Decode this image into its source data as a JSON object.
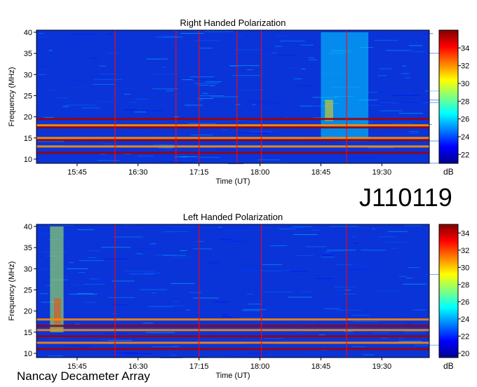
{
  "observation_id": "J110119",
  "station": "Nancay Decameter Array",
  "chart_data": [
    {
      "type": "heatmap",
      "title": "Right Handed Polarization",
      "xlabel": "Time (UT)",
      "ylabel": "Frequency (MHz)",
      "x_ticks": [
        "15:45",
        "16:30",
        "17:15",
        "18:00",
        "18:45",
        "19:30"
      ],
      "x_tick_minutes": [
        945,
        990,
        1035,
        1080,
        1125,
        1170
      ],
      "xlim_minutes": [
        915,
        1205
      ],
      "y_ticks": [
        10,
        15,
        20,
        25,
        30,
        35,
        40
      ],
      "ylim": [
        9,
        40.5
      ],
      "colorbar": {
        "label": "dB",
        "ticks": [
          22,
          24,
          26,
          28,
          30,
          32,
          34
        ],
        "range": [
          21,
          36
        ]
      },
      "strong_bands_mhz": [
        11.5,
        13,
        14.5,
        15,
        17.5,
        18,
        19.5
      ],
      "burst_regions": [
        {
          "t0": 1125,
          "t1": 1160,
          "f0": 15,
          "f1": 40,
          "level": 26
        },
        {
          "t0": 1128,
          "t1": 1134,
          "f0": 19,
          "f1": 24,
          "level": 31
        }
      ],
      "vertical_lines_minutes": [
        973,
        1018,
        1035,
        1063,
        1081,
        1144
      ]
    },
    {
      "type": "heatmap",
      "title": "Left Handed Polarization",
      "xlabel": "Time (UT)",
      "ylabel": "Frequency (MHz)",
      "x_ticks": [
        "15:45",
        "16:30",
        "17:15",
        "18:00",
        "18:45",
        "19:30"
      ],
      "x_tick_minutes": [
        945,
        990,
        1035,
        1080,
        1125,
        1170
      ],
      "xlim_minutes": [
        915,
        1205
      ],
      "y_ticks": [
        10,
        15,
        20,
        25,
        30,
        35,
        40
      ],
      "ylim": [
        9,
        40.5
      ],
      "colorbar": {
        "label": "dB",
        "ticks": [
          20,
          22,
          24,
          26,
          28,
          30,
          32,
          34
        ],
        "range": [
          19.5,
          35
        ]
      },
      "strong_bands_mhz": [
        11,
        12.5,
        14,
        15.5,
        16.5,
        18
      ],
      "burst_regions": [
        {
          "t0": 925,
          "t1": 935,
          "f0": 15,
          "f1": 40,
          "level": 28
        },
        {
          "t0": 928,
          "t1": 933,
          "f0": 17,
          "f1": 23,
          "level": 32
        }
      ],
      "vertical_lines_minutes": [
        973,
        1035,
        1081,
        1144
      ]
    }
  ]
}
